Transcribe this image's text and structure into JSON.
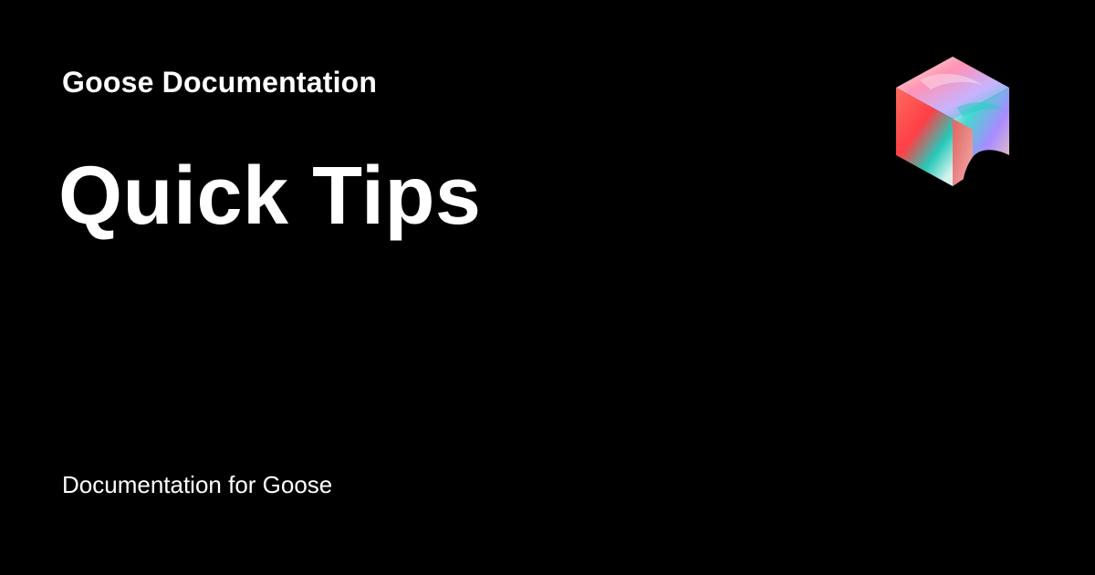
{
  "site": {
    "name": "Goose Documentation"
  },
  "page": {
    "title": "Quick Tips",
    "description": "Documentation for Goose"
  },
  "logo": {
    "icon": "iridescent-cube-logo-icon",
    "colors": {
      "coral": "#ff5a4e",
      "teal": "#1fd0c2",
      "lavender": "#c7b3ff",
      "cream": "#fff2cf",
      "pink": "#ff93b6"
    }
  }
}
